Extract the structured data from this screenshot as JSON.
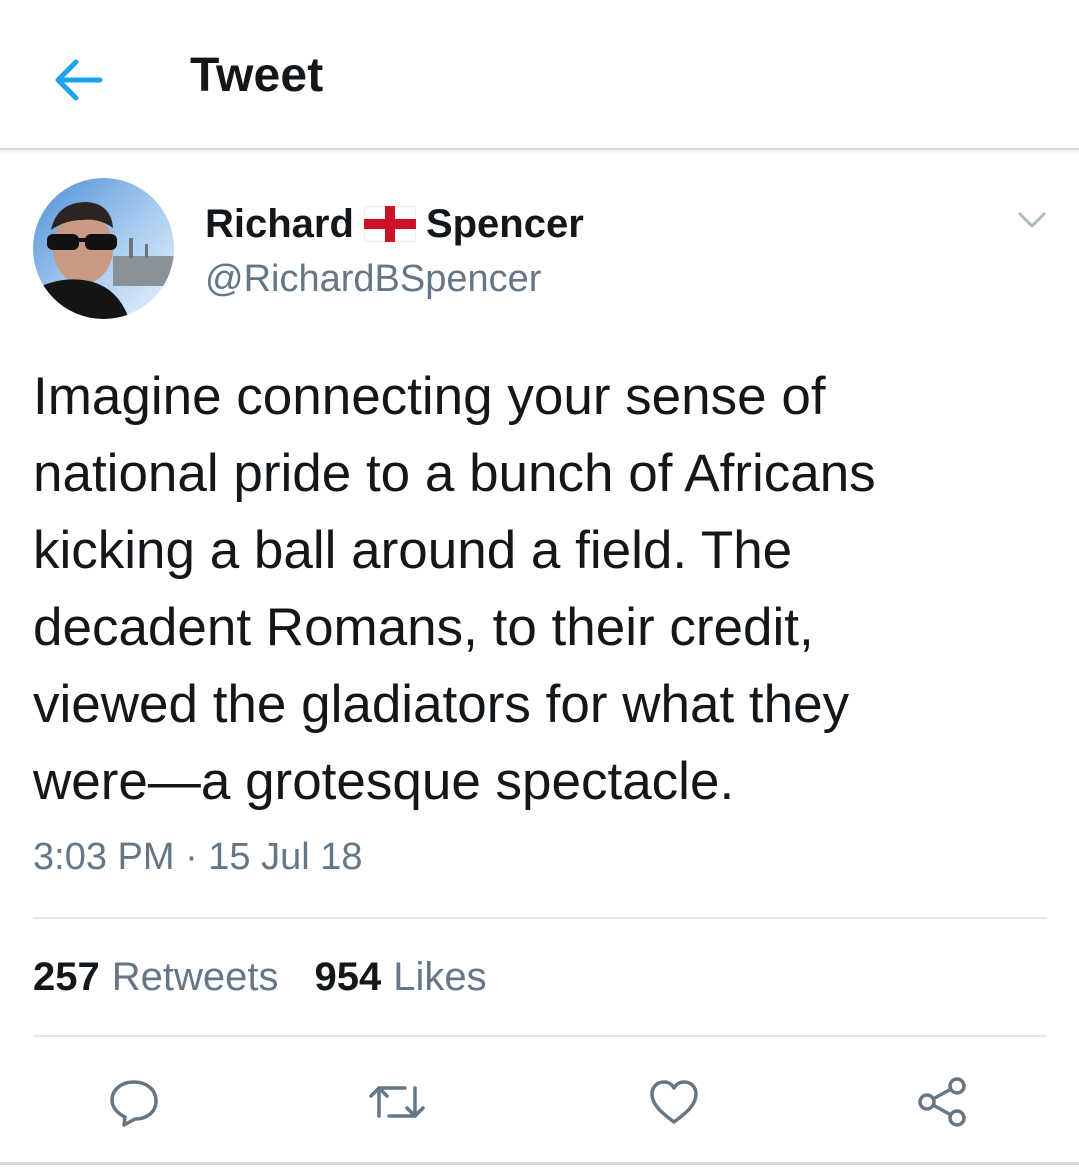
{
  "app_bar": {
    "title": "Tweet",
    "back_icon": "arrow-left-icon",
    "accent_color": "#1da1f2"
  },
  "tweet": {
    "author": {
      "name_first": "Richard",
      "name_emoji": "england-flag-icon",
      "name_last": "Spencer",
      "handle": "@RichardBSpencer"
    },
    "text_lines": [
      "Imagine connecting your sense of",
      "national pride to a bunch of Africans",
      "kicking a ball around a field. The",
      "decadent Romans, to their credit,",
      "viewed the gladiators for what they",
      "were—a grotesque spectacle."
    ],
    "timestamp": "3:03 PM · 15 Jul 18",
    "stats": {
      "retweets_count": "257",
      "retweets_label": "Retweets",
      "likes_count": "954",
      "likes_label": "Likes"
    },
    "actions": [
      "reply-icon",
      "retweet-icon",
      "like-icon",
      "share-icon"
    ]
  },
  "colors": {
    "text_primary": "#14171a",
    "text_secondary": "#657786",
    "divider": "#e1e8ed"
  }
}
